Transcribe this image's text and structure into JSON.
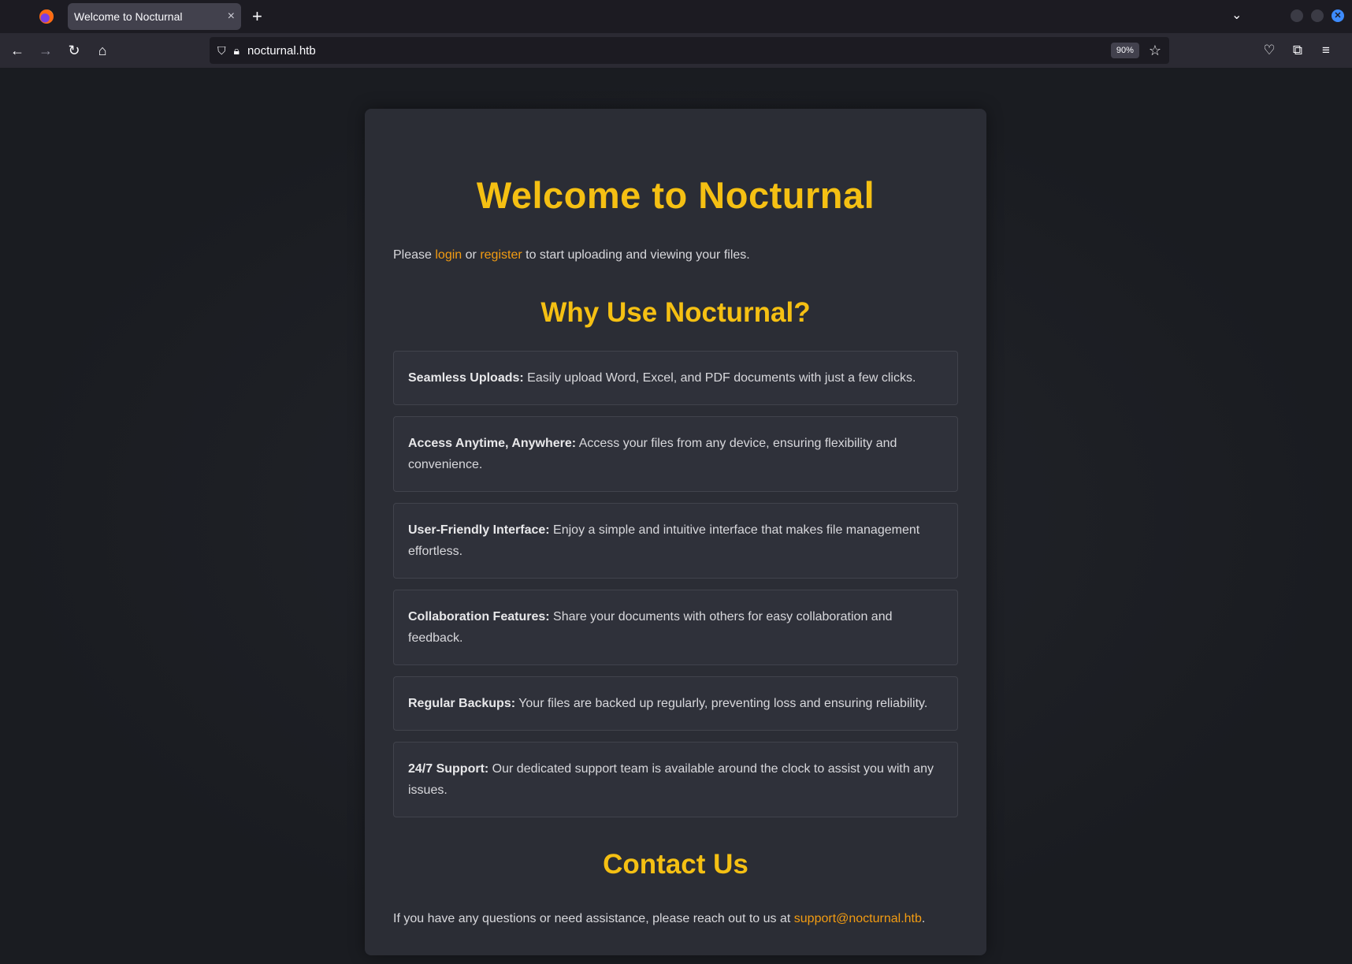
{
  "browser": {
    "tab_title": "Welcome to Nocturnal",
    "tab_close": "×",
    "new_tab": "+",
    "url": "nocturnal.htb",
    "zoom": "90%"
  },
  "page": {
    "title": "Welcome to Nocturnal",
    "intro_before": "Please ",
    "login_label": "login",
    "intro_or": " or ",
    "register_label": "register",
    "intro_after": " to start uploading and viewing your files.",
    "why_heading": "Why Use Nocturnal?",
    "features": [
      {
        "title": "Seamless Uploads:",
        "text": " Easily upload Word, Excel, and PDF documents with just a few clicks."
      },
      {
        "title": "Access Anytime, Anywhere:",
        "text": " Access your files from any device, ensuring flexibility and convenience."
      },
      {
        "title": "User-Friendly Interface:",
        "text": " Enjoy a simple and intuitive interface that makes file management effortless."
      },
      {
        "title": "Collaboration Features:",
        "text": " Share your documents with others for easy collaboration and feedback."
      },
      {
        "title": "Regular Backups:",
        "text": " Your files are backed up regularly, preventing loss and ensuring reliability."
      },
      {
        "title": "24/7 Support:",
        "text": " Our dedicated support team is available around the clock to assist you with any issues."
      }
    ],
    "contact_heading": "Contact Us",
    "contact_before": "If you have any questions or need assistance, please reach out to us at ",
    "contact_email": "support@nocturnal.htb",
    "contact_after": "."
  },
  "colors": {
    "accent": "#f5c013",
    "link": "#f39c12",
    "card": "#2b2d35"
  }
}
